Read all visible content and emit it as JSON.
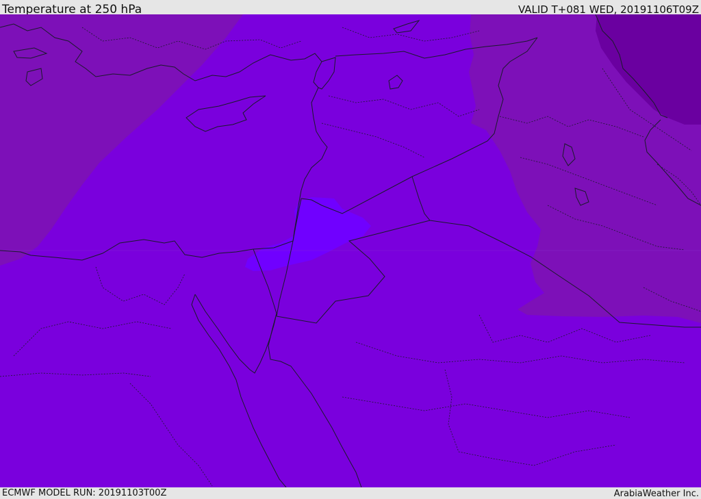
{
  "header": {
    "title": "Temperature at 250 hPa",
    "valid_time": "VALID T+081 WED, 20191106T09Z"
  },
  "footer": {
    "model_run": "ECMWF MODEL RUN: 20191103T00Z",
    "provider": "ArabiaWeather Inc."
  },
  "map": {
    "colors": {
      "base": "#7a00dd",
      "warm_band": "#7d10b8",
      "cold_core": "#6a00a0",
      "light_spot": "#7000ff",
      "coast": "#1a1a2a",
      "border": "#1a1a2a"
    }
  }
}
